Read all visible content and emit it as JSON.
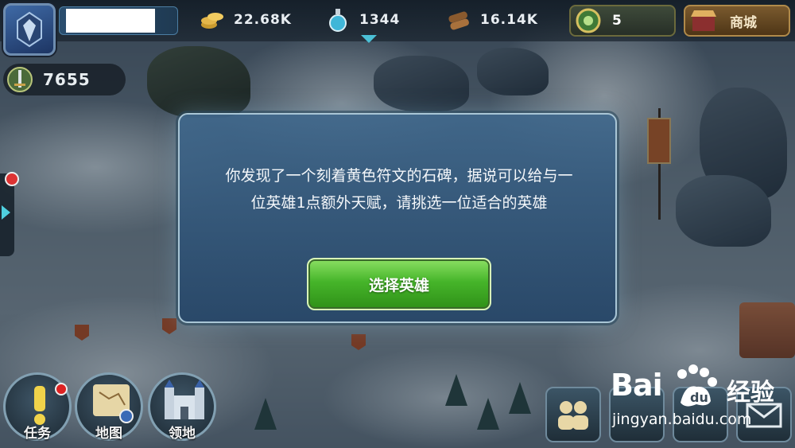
{
  "top_bar": {
    "resources": [
      {
        "name": "gold",
        "icon": "gold-coins-icon",
        "value": "22.68K"
      },
      {
        "name": "mana",
        "icon": "potion-icon",
        "value": "1344"
      },
      {
        "name": "wood",
        "icon": "wood-logs-icon",
        "value": "16.14K"
      }
    ],
    "gems": {
      "icon": "gem-coin-icon",
      "value": "5"
    },
    "shop_label": "商城"
  },
  "power": {
    "icon": "sword-shield-icon",
    "value": "7655"
  },
  "dialog": {
    "message_line1": "你发现了一个刻着黄色符文的石碑，据说可以给与一",
    "message_line2": "位英雄1点额外天赋，请挑选一位适合的英雄",
    "choose_button": "选择英雄"
  },
  "bottom_nav": [
    {
      "label": "任务",
      "icon": "exclamation-icon",
      "badge": true
    },
    {
      "label": "地图",
      "icon": "scroll-map-icon",
      "badge": false
    },
    {
      "label": "领地",
      "icon": "castle-icon",
      "badge": false
    }
  ],
  "watermark": {
    "logo": "Bai",
    "logo_cn": "经验",
    "url": "jingyan.baidu.com"
  },
  "colors": {
    "accent": "#4fd0e0",
    "button_green": "#46b52a",
    "badge_red": "#d22222",
    "modal_border": "#a9c6d6"
  }
}
